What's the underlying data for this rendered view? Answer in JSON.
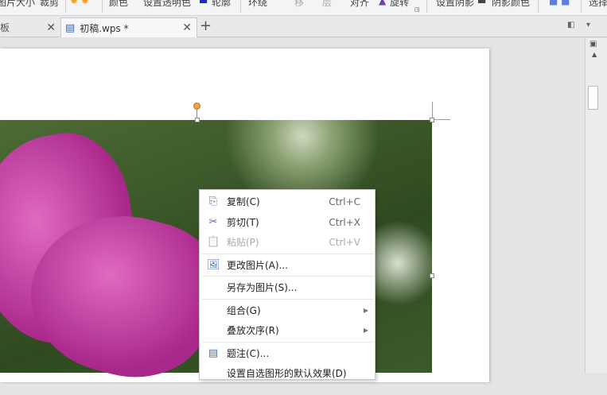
{
  "ribbon": {
    "items": [
      "图片大小",
      "裁剪",
      "颜色",
      "设置透明色",
      "轮廓",
      "环绕",
      "移",
      "层",
      "对齐",
      "旋转",
      "设置阴影",
      "阴影颜色",
      "选择"
    ]
  },
  "tabs": [
    {
      "label": "板"
    },
    {
      "label": "初稿.wps *"
    }
  ],
  "new_tab": "+",
  "menu": [
    {
      "label": "复制(C)",
      "shortcut": "Ctrl+C",
      "icon": "copy-icon",
      "glyph": "⎘",
      "disabled": false
    },
    {
      "label": "剪切(T)",
      "shortcut": "Ctrl+X",
      "icon": "scissors-icon",
      "glyph": "✂",
      "disabled": false
    },
    {
      "label": "粘贴(P)",
      "shortcut": "Ctrl+V",
      "icon": "paste-icon",
      "glyph": "📋",
      "disabled": true
    },
    {
      "label": "更改图片(A)...",
      "icon": "change-picture-icon",
      "glyph": "🖼"
    },
    {
      "label": "另存为图片(S)..."
    },
    {
      "label": "组合(G)",
      "submenu": true
    },
    {
      "label": "叠放次序(R)",
      "submenu": true
    },
    {
      "label": "题注(C)...",
      "icon": "caption-icon",
      "glyph": "▤"
    },
    {
      "label": "设置自选图形的默认效果(D)"
    }
  ]
}
